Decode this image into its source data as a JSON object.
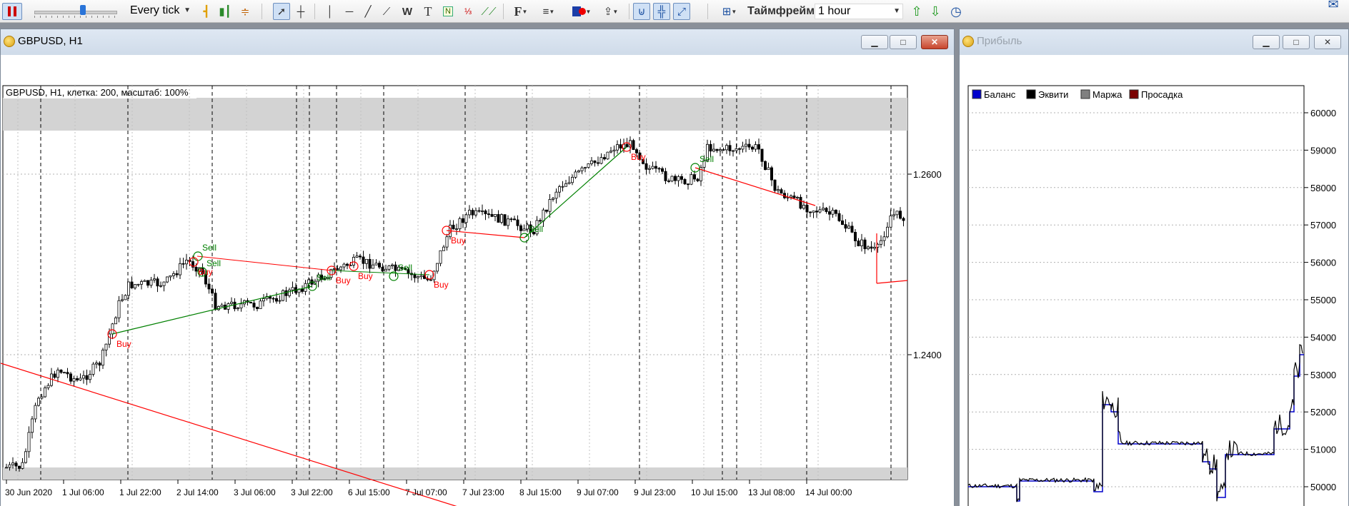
{
  "toolbar": {
    "speed_mode": "Every tick",
    "timeframe_label": "Таймфрейм:",
    "timeframe_value": "1 hour"
  },
  "chart_window": {
    "title": "GBPUSD, H1",
    "info": "GBPUSD, H1, клетка: 200, масштаб: 100%",
    "price_labels": [
      "1.2600",
      "1.2400"
    ],
    "date_labels": [
      "30 Jun 2020",
      "1 Jul 06:00",
      "1 Jul 22:00",
      "2 Jul 14:00",
      "3 Jul 06:00",
      "3 Jul 22:00",
      "6 Jul 15:00",
      "7 Jul 07:00",
      "7 Jul 23:00",
      "8 Jul 15:00",
      "9 Jul 07:00",
      "9 Jul 23:00",
      "10 Jul 15:00",
      "13 Jul 08:00",
      "14 Jul 00:00"
    ],
    "trades": [
      {
        "label": "Buy",
        "type": "buy"
      },
      {
        "label": "Sell",
        "type": "sell"
      },
      {
        "label": "Buy",
        "type": "buy"
      },
      {
        "label": "Sell",
        "type": "sell"
      },
      {
        "label": "Sell",
        "type": "sell"
      },
      {
        "label": "Buy",
        "type": "buy"
      },
      {
        "label": "Buy",
        "type": "buy"
      },
      {
        "label": "Sell",
        "type": "sell"
      },
      {
        "label": "Buy",
        "type": "buy"
      },
      {
        "label": "Buy",
        "type": "buy"
      },
      {
        "label": "Sell",
        "type": "sell"
      },
      {
        "label": "Buy",
        "type": "buy"
      },
      {
        "label": "Sell",
        "type": "sell"
      }
    ]
  },
  "profit_window": {
    "title": "Прибыль",
    "legend": [
      {
        "label": "Баланс",
        "color": "#0000cc"
      },
      {
        "label": "Эквити",
        "color": "#000000"
      },
      {
        "label": "Маржа",
        "color": "#808080"
      },
      {
        "label": "Просадка",
        "color": "#7a0000"
      }
    ],
    "y_labels": [
      "60000",
      "59000",
      "58000",
      "57000",
      "56000",
      "55000",
      "54000",
      "53000",
      "52000",
      "51000",
      "50000"
    ]
  },
  "colors": {
    "buy": "#ff0000",
    "sell": "#008000",
    "candle": "#000000"
  }
}
